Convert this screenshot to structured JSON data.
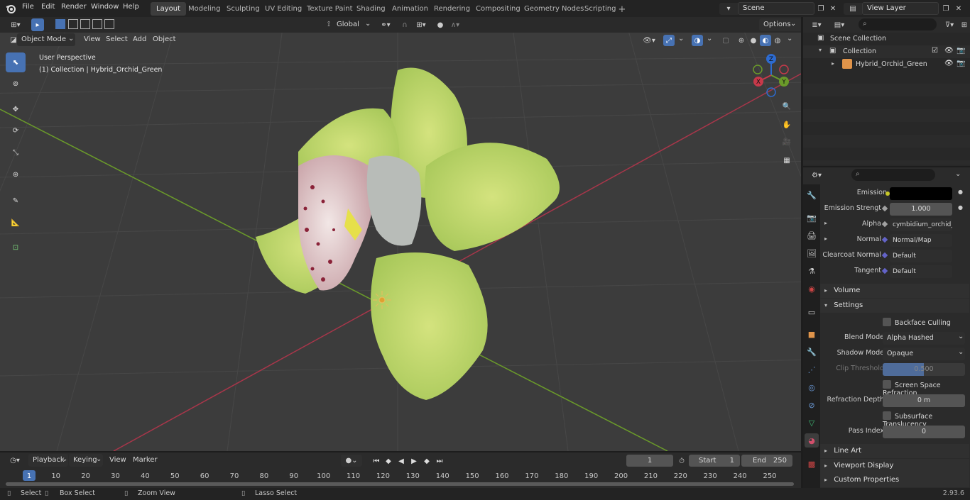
{
  "menus": [
    "File",
    "Edit",
    "Render",
    "Window",
    "Help"
  ],
  "workspaces": [
    "Layout",
    "Modeling",
    "Sculpting",
    "UV Editing",
    "Texture Paint",
    "Shading",
    "Animation",
    "Rendering",
    "Compositing",
    "Geometry Nodes",
    "Scripting"
  ],
  "active_workspace": "Layout",
  "scene_name": "Scene",
  "view_layer": "View Layer",
  "viewport": {
    "mode": "Object Mode",
    "menus": [
      "View",
      "Select",
      "Add",
      "Object"
    ],
    "transform_orientation": "Global",
    "options_label": "Options",
    "perspective_label": "User Perspective",
    "collection_label": "(1) Collection | Hybrid_Orchid_Green",
    "gizmo_axes": {
      "x": "X",
      "y": "Y",
      "z": "Z"
    }
  },
  "outliner": {
    "root": "Scene Collection",
    "collection": "Collection",
    "object": "Hybrid_Orchid_Green"
  },
  "properties": {
    "rows": [
      {
        "label": "Emission",
        "value": "",
        "socket": "#c7c729",
        "type": "color"
      },
      {
        "label": "Emission Strengt",
        "value": "1.000",
        "socket": "#a1a1a1",
        "type": "number"
      },
      {
        "label": "Alpha",
        "value": "cymbidium_orchid_g...",
        "socket": "#a1a1a1",
        "type": "link",
        "expand": true
      },
      {
        "label": "Normal",
        "value": "Normal/Map",
        "socket": "#6363c7",
        "type": "link",
        "expand": true
      },
      {
        "label": "Clearcoat Normal",
        "value": "Default",
        "socket": "#6363c7",
        "type": "link"
      },
      {
        "label": "Tangent",
        "value": "Default",
        "socket": "#6363c7",
        "type": "link"
      }
    ],
    "volume_label": "Volume",
    "settings_label": "Settings",
    "backface_culling": "Backface Culling",
    "blend_mode_label": "Blend Mode",
    "blend_mode_value": "Alpha Hashed",
    "shadow_mode_label": "Shadow Mode",
    "shadow_mode_value": "Opaque",
    "clip_threshold_label": "Clip Threshold",
    "clip_threshold_value": "0.500",
    "clip_threshold_fraction": 0.5,
    "screen_space_refraction": "Screen Space Refraction",
    "refraction_depth_label": "Refraction Depth",
    "refraction_depth_value": "0 m",
    "subsurface_translucency": "Subsurface Translucency",
    "pass_index_label": "Pass Index",
    "pass_index_value": "0",
    "line_art": "Line Art",
    "viewport_display": "Viewport Display",
    "custom_properties": "Custom Properties"
  },
  "timeline": {
    "menus": [
      "Playback",
      "Keying",
      "View",
      "Marker"
    ],
    "current_frame": "1",
    "start_label": "Start",
    "start_value": "1",
    "end_label": "End",
    "end_value": "250",
    "ticks": [
      "1",
      "10",
      "20",
      "30",
      "40",
      "50",
      "60",
      "70",
      "80",
      "90",
      "100",
      "110",
      "120",
      "130",
      "140",
      "150",
      "160",
      "170",
      "180",
      "190",
      "200",
      "210",
      "220",
      "230",
      "240",
      "250"
    ]
  },
  "status": {
    "select": "Select",
    "box_select": "Box Select",
    "zoom_view": "Zoom View",
    "lasso_select": "Lasso Select",
    "version": "2.93.6"
  },
  "colors": {
    "accent": "#4772b3",
    "x_axis": "#c7394a",
    "y_axis": "#6a9a2a",
    "z_axis": "#2d6bd0"
  }
}
